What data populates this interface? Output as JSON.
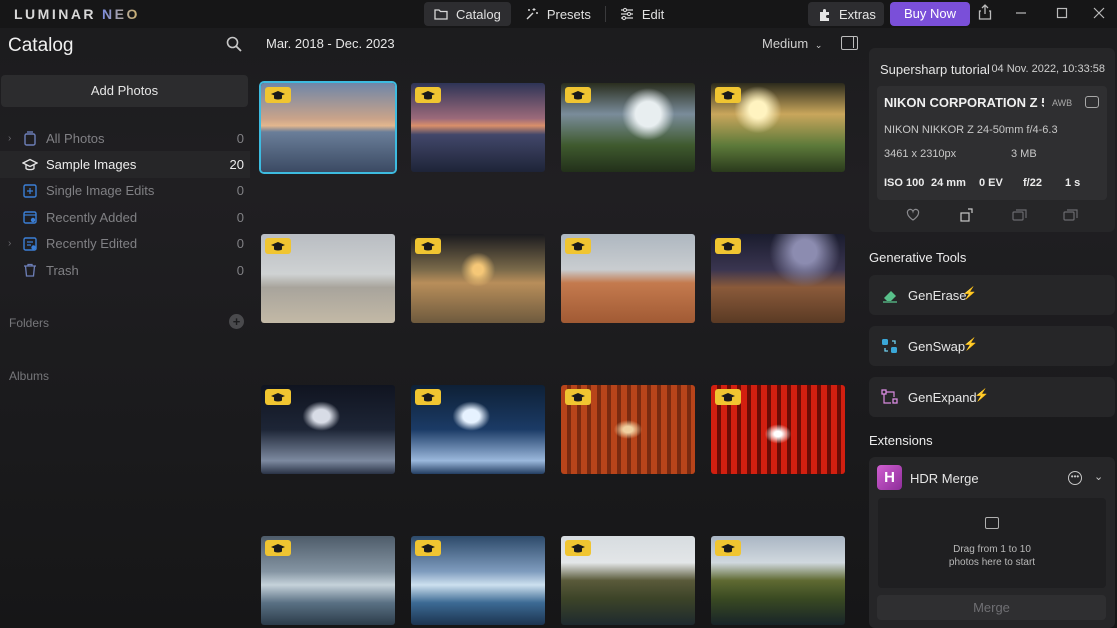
{
  "app": {
    "logo_main": "LUMINAR",
    "logo_accent": "NEO"
  },
  "topbar": {
    "modes": [
      {
        "label": "Catalog",
        "icon": "folder-icon",
        "active": true
      },
      {
        "label": "Presets",
        "icon": "sparkle-icon",
        "active": false
      },
      {
        "label": "Edit",
        "icon": "sliders-icon",
        "active": false
      }
    ],
    "extras_label": "Extras",
    "buy_label": "Buy Now",
    "accent_color": "#7a4fd9"
  },
  "sidebar": {
    "title": "Catalog",
    "add_photos_label": "Add Photos",
    "items": [
      {
        "label": "All Photos",
        "count": "0",
        "icon": "photos-icon"
      },
      {
        "label": "Sample Images",
        "count": "20",
        "icon": "graduation-cap-icon"
      },
      {
        "label": "Single Image Edits",
        "count": "0",
        "icon": "single-image-icon"
      },
      {
        "label": "Recently Added",
        "count": "0",
        "icon": "recently-added-icon"
      },
      {
        "label": "Recently Edited",
        "count": "0",
        "icon": "recently-edited-icon"
      },
      {
        "label": "Trash",
        "count": "0",
        "icon": "trash-icon"
      }
    ],
    "folders_label": "Folders",
    "albums_label": "Albums"
  },
  "main": {
    "date_range": "Mar. 2018 - Dec. 2023",
    "size_label": "Medium",
    "thumbnails": [
      {
        "scene": "iceberg-sunrise",
        "selected": true
      },
      {
        "scene": "iceberg-sunset",
        "selected": false
      },
      {
        "scene": "waterfall-cave",
        "selected": false
      },
      {
        "scene": "waterfall-cave-sun",
        "selected": false
      },
      {
        "scene": "beach-overcast",
        "selected": false
      },
      {
        "scene": "beach-sunset",
        "selected": false
      },
      {
        "scene": "rock-arch",
        "selected": false
      },
      {
        "scene": "rock-arch-night",
        "selected": false
      },
      {
        "scene": "ice-cave-dark",
        "selected": false
      },
      {
        "scene": "ice-cave-blue",
        "selected": false
      },
      {
        "scene": "torii-orange",
        "selected": false
      },
      {
        "scene": "torii-red",
        "selected": false
      },
      {
        "scene": "glacier-lagoon",
        "selected": false
      },
      {
        "scene": "glacier-lagoon-blue",
        "selected": false
      },
      {
        "scene": "mountain-waterfall",
        "selected": false
      },
      {
        "scene": "mountain-waterfall-green",
        "selected": false
      }
    ]
  },
  "info": {
    "name": "Supersharp tutorial",
    "date": "04 Nov. 2022, 10:33:58",
    "camera": "NIKON CORPORATION Z 5",
    "awb": "AWB",
    "lens": "NIKON NIKKOR Z 24-50mm f/4-6.3",
    "resolution": "3461 x 2310px",
    "file_size": "3 MB",
    "iso": "ISO 100",
    "focal": "24 mm",
    "ev": "0 EV",
    "aperture": "f/22",
    "shutter": "1 s"
  },
  "generative": {
    "title": "Generative Tools",
    "tools": [
      {
        "label": "GenErase",
        "icon": "eraser-icon",
        "bolt_color": "#7bd2e8"
      },
      {
        "label": "GenSwap",
        "icon": "swap-icon",
        "bolt_color": "#7bd2e8"
      },
      {
        "label": "GenExpand",
        "icon": "expand-icon",
        "bolt_color": "#d98be0"
      }
    ]
  },
  "extensions": {
    "title": "Extensions",
    "hdr_letter": "H",
    "hdr_label": "HDR Merge",
    "drop_line1": "Drag from 1 to 10",
    "drop_line2": "photos here to start",
    "merge_label": "Merge"
  }
}
